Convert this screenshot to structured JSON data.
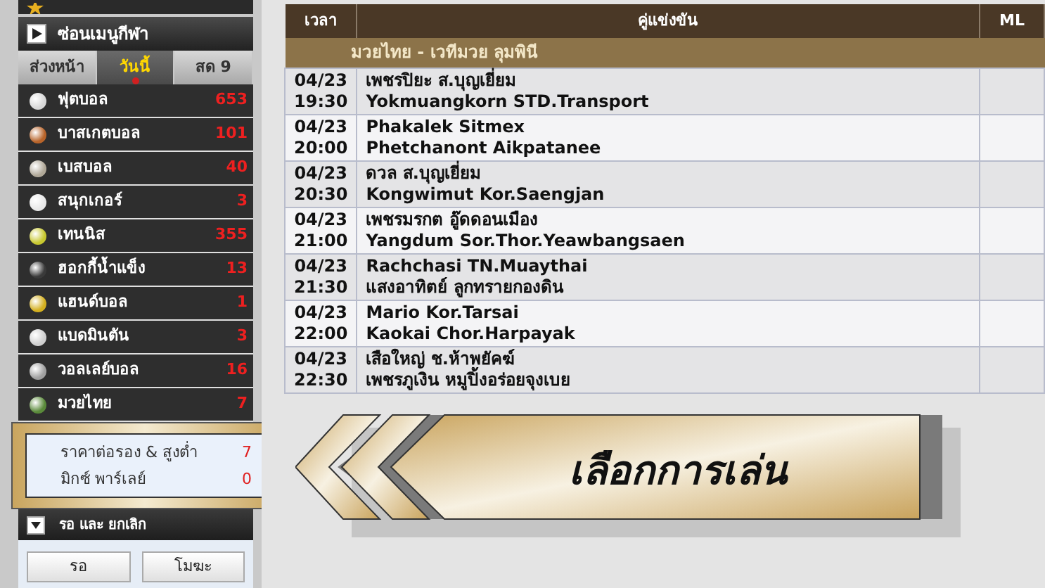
{
  "sidebar": {
    "header": {
      "title": "ซ่อนเมนูกีฬา"
    },
    "tabs": [
      {
        "label": "ส่วงหน้า",
        "selected": false
      },
      {
        "label": "วันนี้",
        "selected": true
      },
      {
        "label": "สด 9",
        "selected": false
      }
    ],
    "sports": [
      {
        "name": "ฟุตบอล",
        "count": "653",
        "color": "#d8d8d8"
      },
      {
        "name": "บาสเกตบอล",
        "count": "101",
        "color": "#b8642a"
      },
      {
        "name": "เบสบอล",
        "count": "40",
        "color": "#b0a898"
      },
      {
        "name": "สนุกเกอร์",
        "count": "3",
        "color": "#e8e8e8"
      },
      {
        "name": "เทนนิส",
        "count": "355",
        "color": "#c8c830"
      },
      {
        "name": "ฮอกกี้น้ำแข็ง",
        "count": "13",
        "color": "#3a3a3a"
      },
      {
        "name": "แฮนด์บอล",
        "count": "1",
        "color": "#d4b020"
      },
      {
        "name": "แบดมินตัน",
        "count": "3",
        "color": "#d0d0d0"
      },
      {
        "name": "วอลเลย์บอล",
        "count": "16",
        "color": "#a0a0a0"
      },
      {
        "name": "มวยไทย",
        "count": "7",
        "color": "#5a8a3a"
      }
    ],
    "bet_types": [
      {
        "label": "ราคาต่อรอง & สูงต่ำ",
        "count": "7"
      },
      {
        "label": "มิกซ์ พาร์เลย์",
        "count": "0"
      }
    ],
    "section": {
      "title": "รอ และ ยกเลิก"
    },
    "buttons": [
      "รอ",
      "โมฆะ"
    ]
  },
  "table": {
    "columns": [
      "เวลา",
      "คู่แข่งขัน",
      "ML"
    ],
    "league": "มวยไทย - เวทีมวย ลุมพินี",
    "rows": [
      {
        "date": "04/23",
        "time": "19:30",
        "home": "เพชรปิยะ ส.บุญเยี่ยม",
        "away": "Yokmuangkorn STD.Transport"
      },
      {
        "date": "04/23",
        "time": "20:00",
        "home": "Phakalek Sitmex",
        "away": "Phetchanont Aikpatanee"
      },
      {
        "date": "04/23",
        "time": "20:30",
        "home": "ดวล ส.บุญเยี่ยม",
        "away": "Kongwimut Kor.Saengjan"
      },
      {
        "date": "04/23",
        "time": "21:00",
        "home": "เพชรมรกต อู๊ดดอนเมือง",
        "away": "Yangdum Sor.Thor.Yeawbangsaen"
      },
      {
        "date": "04/23",
        "time": "21:30",
        "home": "Rachchasi TN.Muaythai",
        "away": "แสงอาทิตย์ ลูกทรายกองดิน"
      },
      {
        "date": "04/23",
        "time": "22:00",
        "home": "Mario Kor.Tarsai",
        "away": "Kaokai Chor.Harpayak"
      },
      {
        "date": "04/23",
        "time": "22:30",
        "home": "เสือใหญ่ ช.ห้าพยัคฆ์",
        "away": "เพชรภูเงิน หมูปิ้งอร่อยจุงเบย"
      }
    ]
  },
  "banner": {
    "label": "เลือกการเล่น"
  }
}
